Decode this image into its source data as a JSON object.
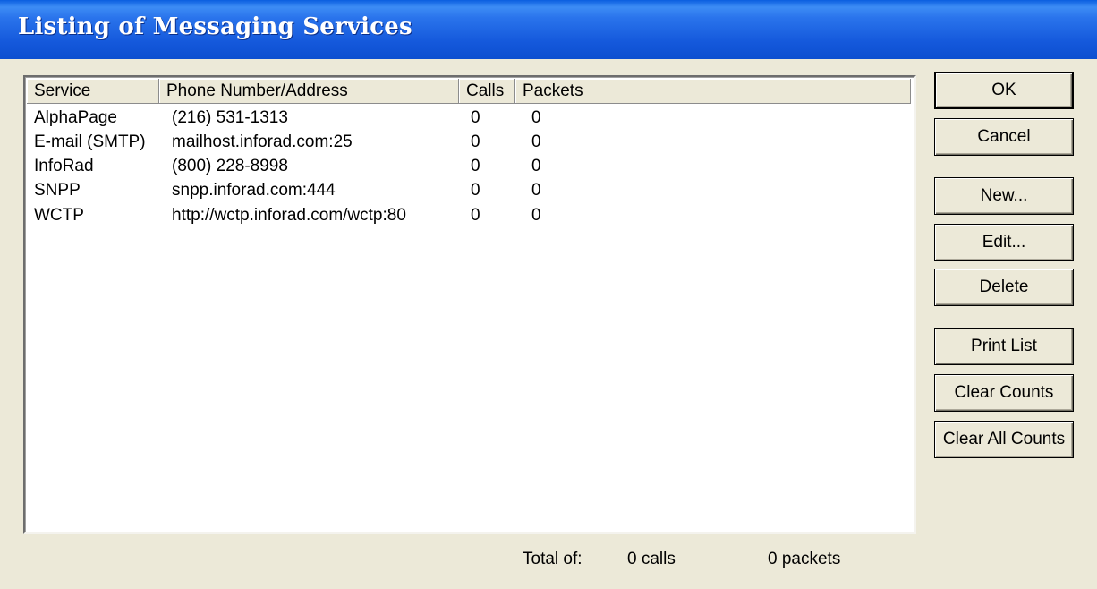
{
  "window": {
    "title": "Listing of Messaging Services"
  },
  "list": {
    "columns": [
      "Service",
      "Phone Number/Address",
      "Calls",
      "Packets"
    ],
    "rows": [
      {
        "service": "AlphaPage",
        "address": "(216) 531-1313",
        "calls": "0",
        "packets": "0"
      },
      {
        "service": "E-mail (SMTP)",
        "address": "mailhost.inforad.com:25",
        "calls": "0",
        "packets": "0"
      },
      {
        "service": "InfoRad",
        "address": "(800) 228-8998",
        "calls": "0",
        "packets": "0"
      },
      {
        "service": "SNPP",
        "address": "snpp.inforad.com:444",
        "calls": "0",
        "packets": "0"
      },
      {
        "service": "WCTP",
        "address": "http://wctp.inforad.com/wctp:80",
        "calls": "0",
        "packets": "0"
      }
    ]
  },
  "buttons": {
    "ok": "OK",
    "cancel": "Cancel",
    "new": "New...",
    "edit": "Edit...",
    "delete": "Delete",
    "print_list": "Print List",
    "clear_counts": "Clear Counts",
    "clear_all_counts": "Clear All Counts"
  },
  "footer": {
    "total_label": "Total of:",
    "calls_total": "0 calls",
    "packets_total": "0 packets"
  }
}
